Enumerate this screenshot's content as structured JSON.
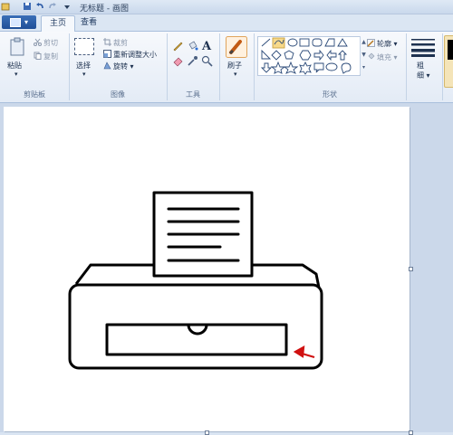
{
  "window": {
    "title": "无标题 - 画图"
  },
  "tabs": [
    {
      "label": "主页",
      "active": true
    },
    {
      "label": "查看",
      "active": false
    }
  ],
  "groups": {
    "clipboard": {
      "label": "剪贴板",
      "paste": "粘贴",
      "cut": "剪切",
      "copy": "复制"
    },
    "image": {
      "label": "图像",
      "select": "选择",
      "crop": "裁剪",
      "resize": "重新调整大小",
      "rotate": "旋转 ▾"
    },
    "tools": {
      "label": "工具"
    },
    "brush": {
      "label": "刷子"
    },
    "shapes": {
      "label": "形状",
      "outline": "轮廓 ▾",
      "fill": "填充 ▾"
    },
    "size": {
      "label": "粗\n细 ▾"
    }
  },
  "colors": {
    "accent": "#2b5aa6",
    "canvas": "#ffffff",
    "arrow": "#d01010"
  }
}
